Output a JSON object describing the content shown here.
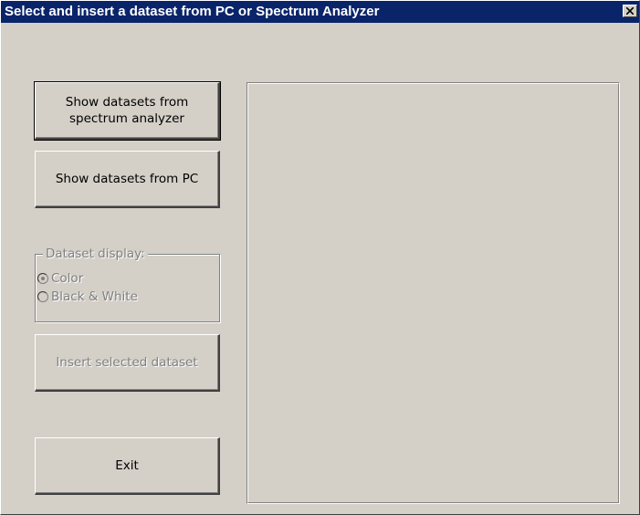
{
  "window": {
    "title": "Select and insert a dataset from PC or Spectrum Analyzer",
    "close_icon": "close-icon"
  },
  "buttons": {
    "show_analyzer": "Show datasets from spectrum analyzer",
    "show_pc": "Show datasets from PC",
    "insert": "Insert selected dataset",
    "exit": "Exit"
  },
  "dataset_display": {
    "legend": "Dataset display:",
    "options": [
      "Color",
      "Black & White"
    ],
    "selected": "Color",
    "enabled": false
  },
  "colors": {
    "titlebar": "#0a246a",
    "face": "#d4d0c8",
    "disabled_text": "#808080"
  }
}
